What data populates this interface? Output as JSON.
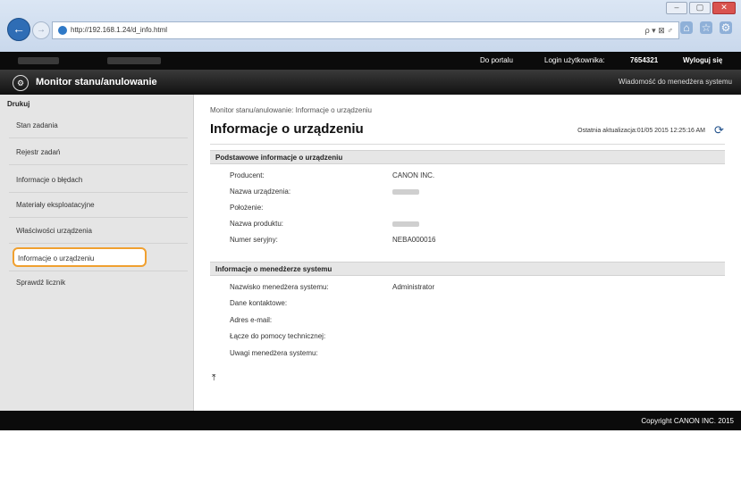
{
  "browser": {
    "url": "http://192.168.1.24/d_info.html",
    "url_right": "ρ ▾ ⊠ ♂"
  },
  "topbar": {
    "portal_link": "Do portalu",
    "login_label": "Login użytkownika:",
    "login_id": "7654321",
    "logout_link": "Wyloguj się"
  },
  "header": {
    "app_title": "Monitor stanu/anulowanie",
    "sys_msg": "Wiadomość do menedżera systemu"
  },
  "sidebar": {
    "header": "Drukuj",
    "items": [
      {
        "label": "Stan zadania"
      },
      {
        "label": "Rejestr zadań"
      },
      {
        "label": "Informacje o błędach"
      },
      {
        "label": "Materiały eksploatacyjne"
      },
      {
        "label": "Właściwości urządzenia"
      },
      {
        "label": "Informacje o urządzeniu"
      },
      {
        "label": "Sprawdź licznik"
      }
    ]
  },
  "main": {
    "breadcrumb": "Monitor stanu/anulowanie: Informacje o urządzeniu",
    "title": "Informacje o urządzeniu",
    "last_update": "Ostatnia aktualizacja:01/05 2015 12:25:16 AM",
    "sections": [
      {
        "header": "Podstawowe informacje o urządzeniu",
        "rows": [
          {
            "label": "Producent:",
            "value": "CANON INC."
          },
          {
            "label": "Nazwa urządzenia:",
            "value": ""
          },
          {
            "label": "Położenie:",
            "value": ""
          },
          {
            "label": "Nazwa produktu:",
            "value": ""
          },
          {
            "label": "Numer seryjny:",
            "value": "NEBA000016"
          }
        ]
      },
      {
        "header": "Informacje o menedżerze systemu",
        "rows": [
          {
            "label": "Nazwisko menedżera systemu:",
            "value": "Administrator"
          },
          {
            "label": "Dane kontaktowe:",
            "value": ""
          },
          {
            "label": "Adres e-mail:",
            "value": ""
          },
          {
            "label": "Łącze do pomocy technicznej:",
            "value": ""
          },
          {
            "label": "Uwagi menedżera systemu:",
            "value": ""
          }
        ]
      }
    ]
  },
  "footer": {
    "copyright": "Copyright CANON INC. 2015"
  },
  "colors": {
    "active_highlight": "#f0a030",
    "topbar": "#0b0b0b"
  }
}
